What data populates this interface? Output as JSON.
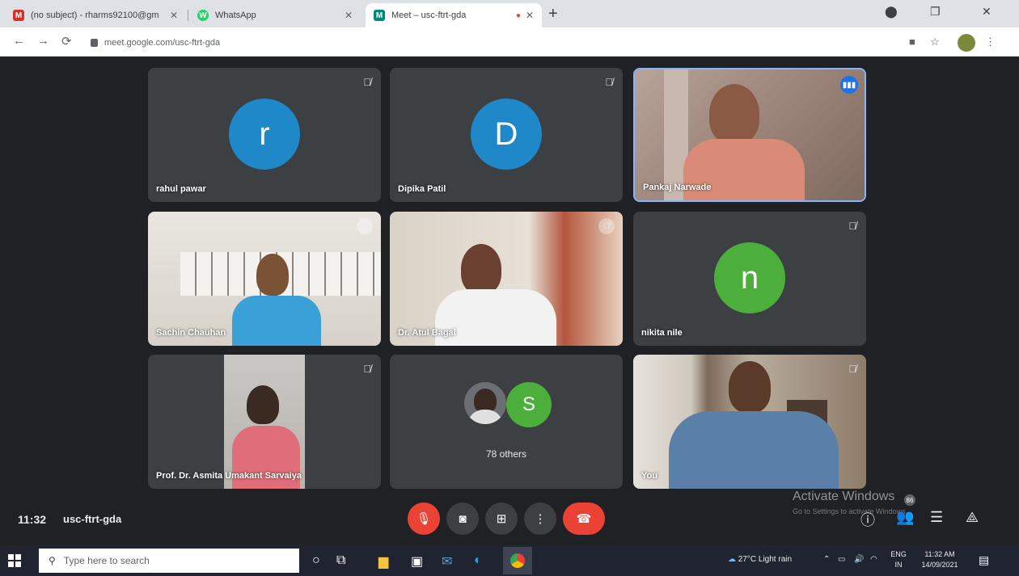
{
  "browser": {
    "tabs": [
      {
        "title": "(no subject) - rharms92100@gm",
        "favicon": "M",
        "color": "#d93025",
        "active": false
      },
      {
        "title": "WhatsApp",
        "favicon": "W",
        "color": "#25d366",
        "active": false
      },
      {
        "title": "Meet – usc-ftrt-gda",
        "favicon": "M",
        "color": "#00897b",
        "active": true
      }
    ],
    "url": "meet.google.com/usc-ftrt-gda",
    "new_tab": "+"
  },
  "tiles": [
    {
      "name": "rahul pawar",
      "initial": "r",
      "avatar_color": "#1e88c9"
    },
    {
      "name": "Dipika Patil",
      "initial": "D",
      "avatar_color": "#1e88c9"
    },
    {
      "name": "Pankaj Narwade",
      "initial": "",
      "avatar_color": ""
    },
    {
      "name": "Sachin Chauhan",
      "initial": "",
      "avatar_color": ""
    },
    {
      "name": "Dr. Atul Bagal",
      "initial": "",
      "avatar_color": ""
    },
    {
      "name": "nikita nile",
      "initial": "n",
      "avatar_color": "#4caf3c"
    },
    {
      "name": "Prof. Dr. Asmita Umakant Sarvaiya",
      "initial": "",
      "avatar_color": ""
    },
    {
      "name": "78 others",
      "initial": "S",
      "avatar_color": "#4caf3c"
    },
    {
      "name": "You",
      "initial": "",
      "avatar_color": ""
    }
  ],
  "meeting": {
    "time": "11:32",
    "code": "usc-ftrt-gda",
    "participant_count": "86"
  },
  "watermark": {
    "title": "Activate Windows",
    "subtitle": "Go to Settings to activate Windows."
  },
  "taskbar": {
    "search_placeholder": "Type here to search",
    "weather": "27°C  Light rain",
    "lang_top": "ENG",
    "lang_bottom": "IN",
    "time": "11:32 AM",
    "date": "14/09/2021"
  },
  "colors": {
    "stage_bg": "#202124",
    "tile_bg": "#3c4043",
    "end_call": "#ea4335",
    "speaking_border": "#8ab4f8"
  }
}
